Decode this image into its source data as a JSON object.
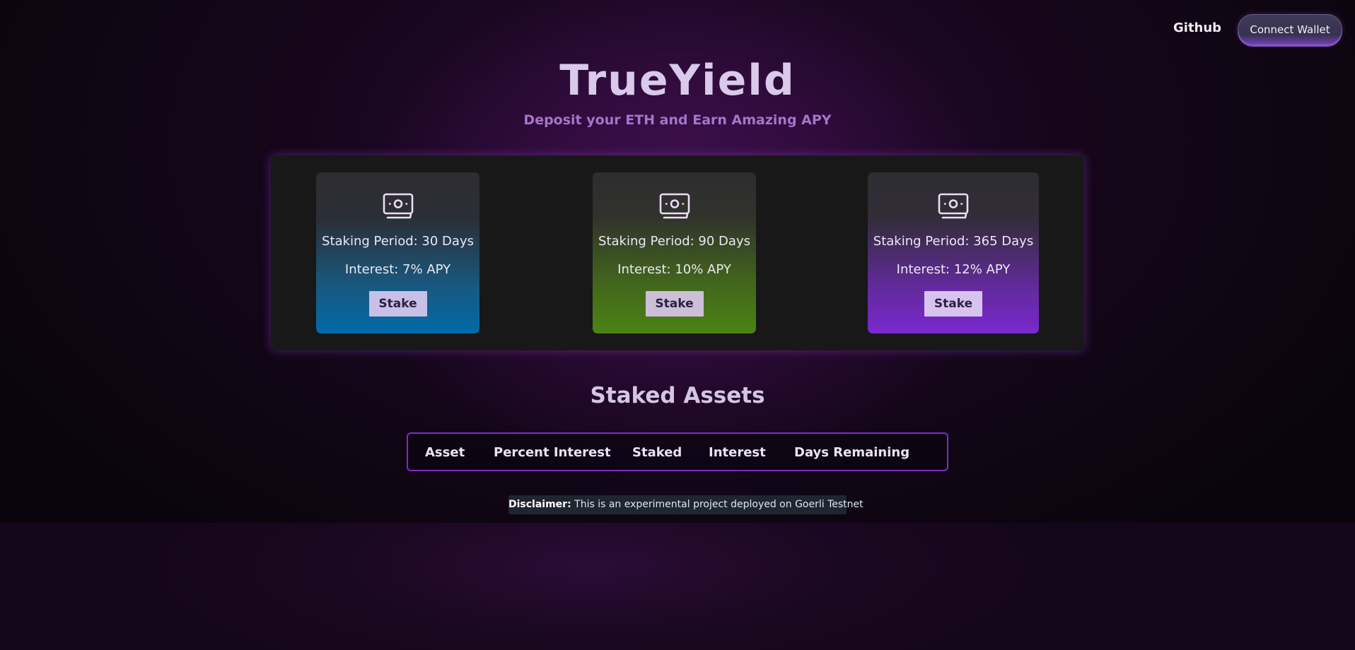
{
  "header": {
    "github_label": "Github",
    "connect_label": "Connect Wallet"
  },
  "hero": {
    "title": "TrueYield",
    "subtitle": "Deposit your ETH and Earn Amazing APY"
  },
  "staking_options": [
    {
      "period": "Staking Period: 30 Days",
      "interest": "Interest: 7% APY",
      "button": "Stake",
      "icon": "money-icon"
    },
    {
      "period": "Staking Period: 90 Days",
      "interest": "Interest: 10% APY",
      "button": "Stake",
      "icon": "money-icon"
    },
    {
      "period": "Staking Period: 365 Days",
      "interest": "Interest: 12% APY",
      "button": "Stake",
      "icon": "money-icon"
    }
  ],
  "staked_assets": {
    "title": "Staked Assets",
    "columns": [
      "Asset",
      "Percent Interest",
      "Staked",
      "Interest",
      "Days Remaining"
    ]
  },
  "disclaimer": {
    "label": "Disclaimer:",
    "text": "This is an experimental project deployed on Goerli Testnet"
  },
  "colors": {
    "accent": "#7d2cc6",
    "card_30_days": "#006ba8",
    "card_90_days": "#4b8314",
    "card_365_days": "#7a28cf"
  }
}
